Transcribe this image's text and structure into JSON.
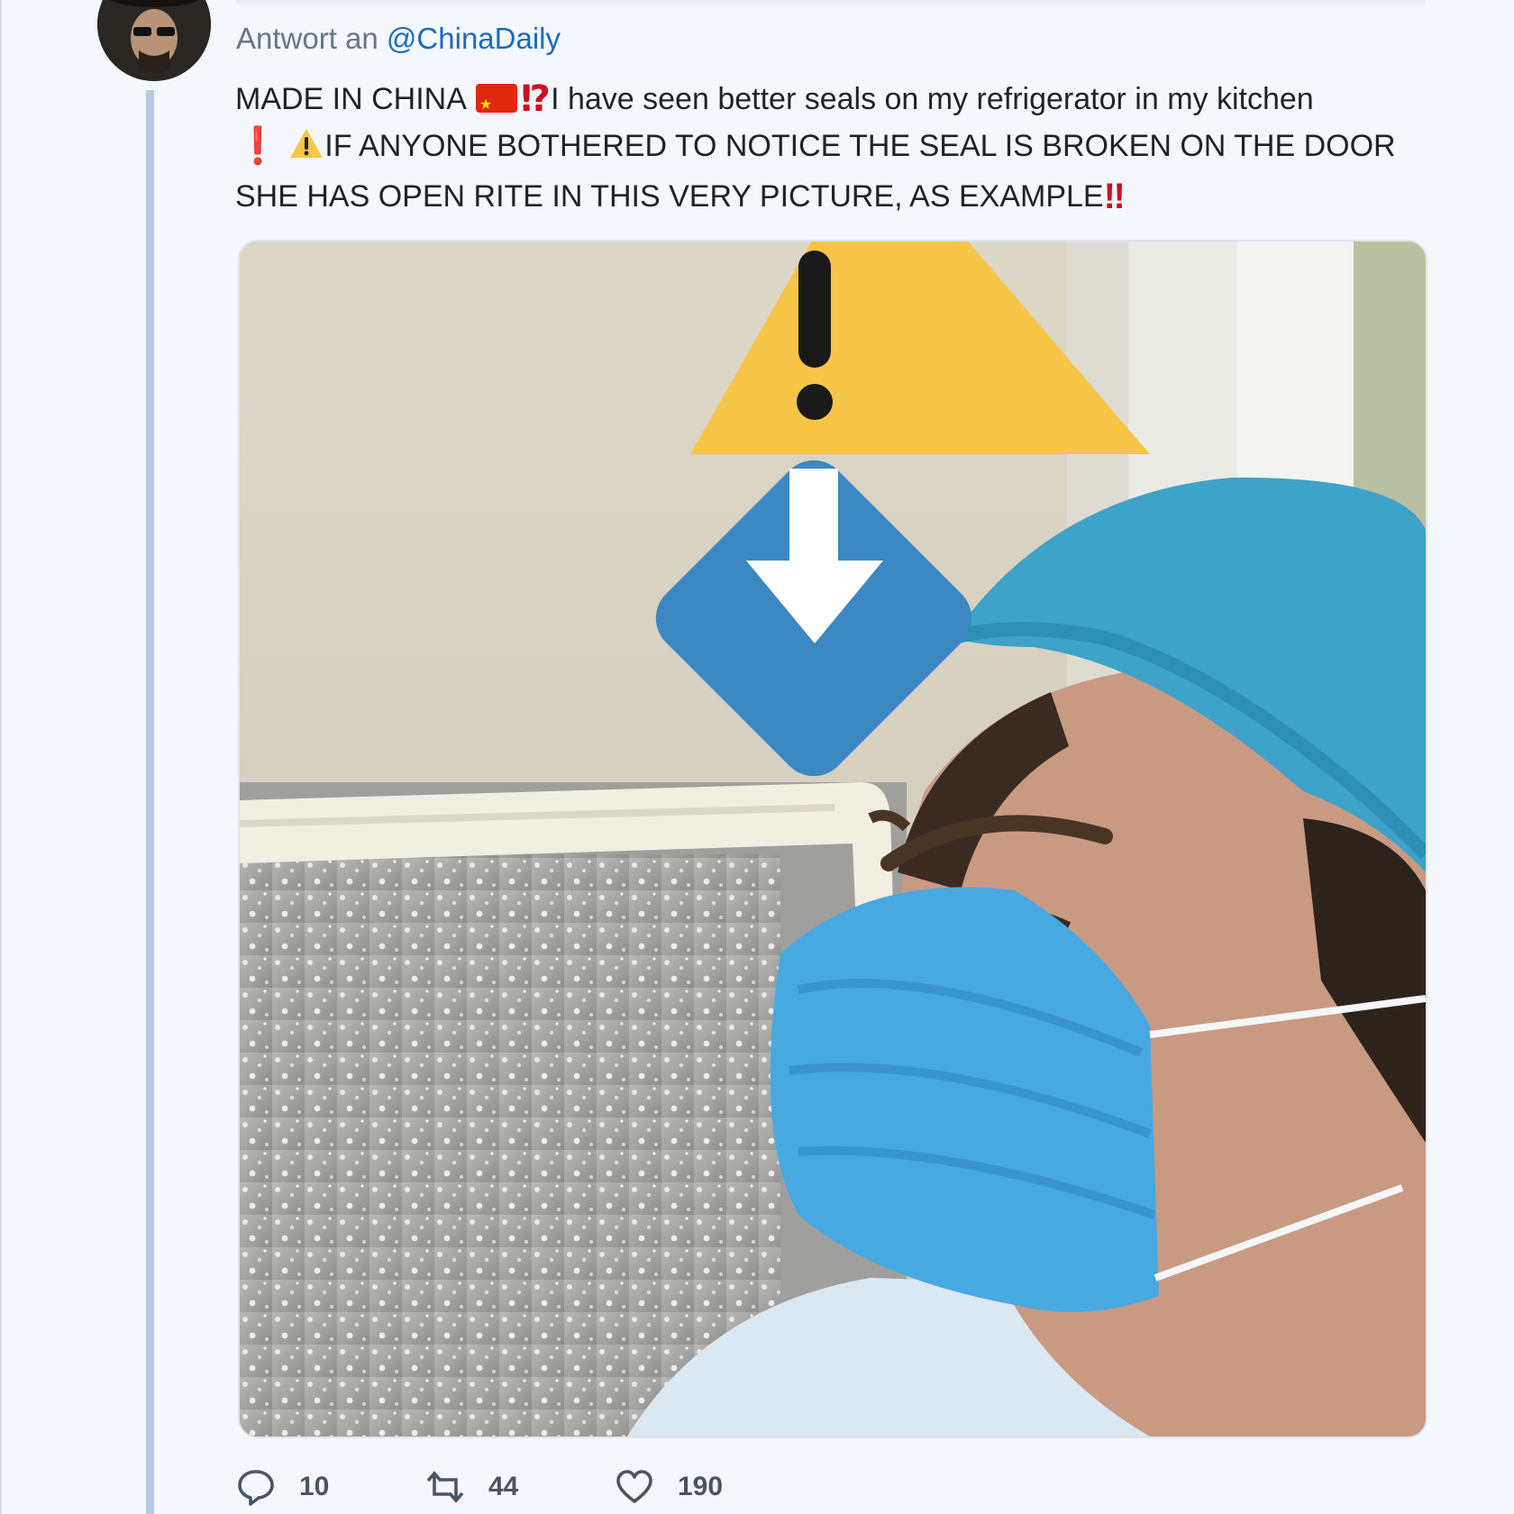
{
  "tweet": {
    "reply_prefix": "Antwort an",
    "reply_handle": "@ChinaDaily",
    "text_line1_a": "MADE IN CHINA",
    "text_line1_b": "I have seen better seals on my refrigerator in my kitchen",
    "text_line2": "IF ANYONE BOTHERED TO NOTICE THE SEAL IS BROKEN ON THE DOOR",
    "text_line3": "SHE HAS OPEN RITE IN THIS VERY PICTURE, AS EXAMPLE",
    "emoji": {
      "flag": "flag-china-icon",
      "interrobang": "⁉",
      "exclamation": "❗",
      "warning": "⚠",
      "double_exclamation": "‼"
    }
  },
  "media": {
    "overlay_icons": [
      "warning-icon",
      "down-arrow-icon"
    ],
    "colors": {
      "warning": "#f7c548",
      "arrow_box": "#3b88c3",
      "mask": "#48a8e0",
      "hair_cap": "#3fa2c8"
    }
  },
  "actions": {
    "reply_count": "10",
    "retweet_count": "44",
    "like_count": "190"
  }
}
